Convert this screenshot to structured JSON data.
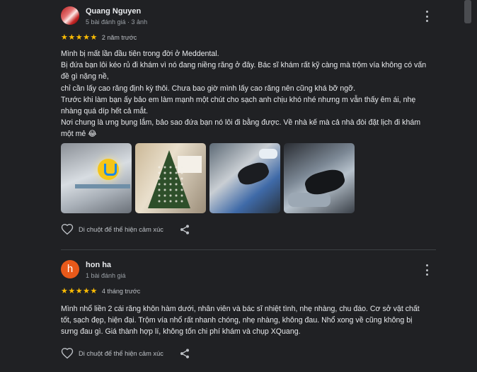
{
  "reviews": [
    {
      "author": "Quang Nguyen",
      "meta": "5 bài đánh giá · 3 ảnh",
      "stars": "★★★★★",
      "date": "2 năm trước",
      "text": "Mình bị mất lần đầu tiên trong đời ở Meddental.\nBị đứa bạn lôi kéo rủ đi khám vì nó đang niềng răng ở đây. Bác sĩ khám rất kỹ càng mà trộm vía không có vấn đề gì nặng nề,\nchỉ cần lấy cao răng định kỳ thôi. Chưa bao giờ mình lấy cao răng nên cũng khá bỡ ngỡ.\nTrước khi làm bạn ấy bảo em làm mạnh một chút cho sạch anh chịu khó nhé nhưng m vẫn thấy êm ái, nhẹ nhàng quá díp hết cả mắt.\nNơi chung là ưng bụng lắm, bảo sao đứa bạn nó lôi đi bằng được. Về nhà kế mà cả nhà đòi đặt lịch đi khám một mẻ 😂",
      "react_label": "Di chuột để thể hiện cảm xúc",
      "avatar_letter": ""
    },
    {
      "author": "hon ha",
      "meta": "1 bài đánh giá",
      "stars": "★★★★★",
      "date": "4 tháng trước",
      "text": "Mình nhổ liền 2 cái răng khôn hàm dưới, nhân viên và bác sĩ nhiệt tình, nhẹ nhàng, chu đáo. Cơ sở vật chất tốt, sạch đẹp, hiện đại. Trộm vía nhổ rất nhanh chóng, nhẹ nhàng, không đau. Nhổ xong về cũng không bị sưng đau gì. Giá thành hợp lí, không tốn chi phí khám và chụp XQuang.",
      "react_label": "Di chuột để thể hiện cảm xúc",
      "avatar_letter": "h"
    }
  ],
  "colors": {
    "background": "#202124",
    "star": "#fbbc04",
    "avatar_h": "#e8591a"
  }
}
